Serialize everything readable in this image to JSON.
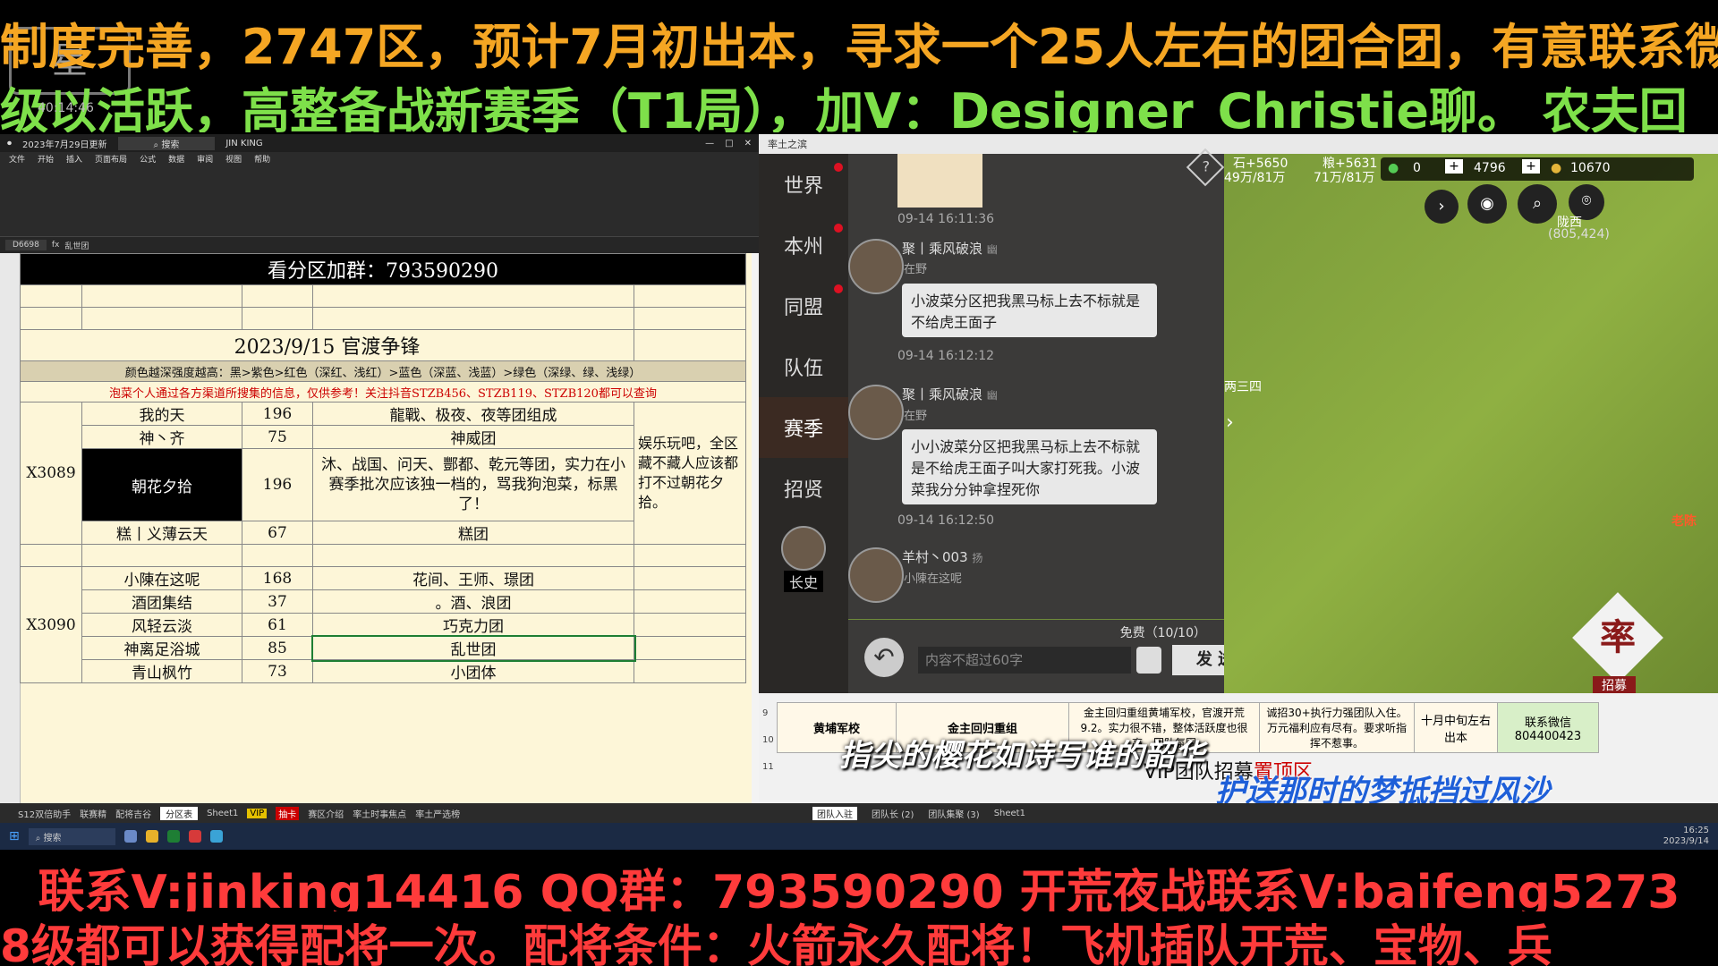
{
  "banners": {
    "top1": "制度完善，2747区，预计7月初出本，寻求一个25人左右的团合团，有意联系微信",
    "top2": "级以活跃，高整备战新赛季（T1局），加V：Designer_Christie聊。    农夫回",
    "bottom1": "联系V:jinking14416    QQ群：793590290  开荒夜战联系V:baifeng5273",
    "bottom2": "8级都可以获得配将一次。配将条件：火箭永久配将！飞机插队开荒、宝物、兵",
    "stamp": "40:14:46"
  },
  "excel": {
    "window_title": "2023年7月29日更新",
    "search_placeholder": "搜索",
    "user": "JIN KING",
    "menu": [
      "文件",
      "开始",
      "插入",
      "页面布局",
      "公式",
      "数据",
      "审阅",
      "视图",
      "帮助"
    ],
    "cell_ref": "D6698",
    "formula": "乱世团",
    "header": "看分区加群：793590290",
    "date_title": "2023/9/15  官渡争锋",
    "legend": "颜色越深强度越高：黑>紫色>红色（深红、浅红）>蓝色（深蓝、浅蓝）>绿色（深绿、绿、浅绿）",
    "notice": "泡菜个人通过各方渠道所搜集的信息，仅供参考！关注抖音STZB456、STZB119、STZB120都可以查询",
    "groups": [
      {
        "zone": "X3089",
        "rows": [
          {
            "name": "我的天",
            "num": "196",
            "note": "龍戰、极夜、夜等团组成"
          },
          {
            "name": "神丶齐",
            "num": "75",
            "note": "神威团"
          },
          {
            "name": "朝花夕拾",
            "num": "196",
            "note": "沐、战国、问天、酆都、乾元等团，实力在小赛季批次应该独一档的，骂我狗泡菜，标黑了！"
          },
          {
            "name": "糕丨义薄云天",
            "num": "67",
            "note": "糕团"
          }
        ],
        "remark": "娱乐玩吧，全区藏不藏人应该都打不过朝花夕拾。"
      },
      {
        "zone": "X3090",
        "rows": [
          {
            "name": "小陳在这呢",
            "num": "168",
            "note": "花间、王师、璟团"
          },
          {
            "name": "酒团集结",
            "num": "37",
            "note": "。酒、浪团"
          },
          {
            "name": "风轻云淡",
            "num": "61",
            "note": "巧克力团"
          },
          {
            "name": "神离足浴城",
            "num": "85",
            "note": "乱世团"
          },
          {
            "name": "青山枫竹",
            "num": "73",
            "note": "小团体"
          }
        ]
      }
    ],
    "sheet_tabs": [
      "S12双倍助手",
      "联赛精",
      "配将吉谷",
      "分区表",
      "Sheet1",
      "VIP",
      "抽卡",
      "赛区介绍",
      "率土时事焦点",
      "率土严选榜"
    ]
  },
  "game": {
    "window_title": "率土之滨",
    "sidebar": [
      "世界",
      "本州",
      "同盟",
      "队伍",
      "赛季",
      "招贤"
    ],
    "sidebar_role": "长史",
    "messages": [
      {
        "time": "09-14 16:11:36"
      },
      {
        "name": "聚丨乘风破浪",
        "tag": "幽",
        "status": "在野",
        "text": "小波菜分区把我黑马标上去不标就是不给虎王面子",
        "time": "09-14 16:12:12"
      },
      {
        "name": "聚丨乘风破浪",
        "tag": "幽",
        "status": "在野",
        "text": "小小波菜分区把我黑马标上去不标就是不给虎王面子叫大家打死我。小波菜我分分钟拿捏死你",
        "time": "09-14 16:12:50"
      },
      {
        "name": "羊村丶003",
        "tag": "扬",
        "status": "小陳在这呢"
      }
    ],
    "free_label": "免费（10/10）",
    "input_placeholder": "内容不超过60字",
    "send_label": "发 送",
    "resources": {
      "stone": "石+5650",
      "stone_cap": "49万/81万",
      "grain": "粮+5631",
      "grain_cap": "71万/81万",
      "jade": "0",
      "gold": "4796",
      "copper": "10670"
    },
    "location": "陇西",
    "coords": "(805,424)",
    "map_label": "两三四",
    "npc_label": "老陈",
    "recruit_label": "招募",
    "recruit_big": "率"
  },
  "strip": {
    "cells": [
      "黄埔军校",
      "金主回归重组",
      "金主回归重组黄埔军校，官渡开荒9.2。实力很不错，整体活跃度也很高。团队氛围",
      "诚招30+执行力强团队入住。万元福利应有尽有。要求听指挥不惹事。",
      "十月中旬左右出本",
      "联系微信804400423"
    ],
    "row_nums": [
      "9",
      "10",
      "11"
    ],
    "overlay": "VIP团队招募",
    "overlay_red": "置顶区",
    "lyric1": "指尖的樱花如诗写谁的韶华",
    "lyric2": "护送那时的梦抵挡过风沙",
    "tabs": [
      "团队入驻",
      "团队长 (2)",
      "团队集聚 (3)",
      "Sheet1"
    ]
  },
  "taskbar": {
    "search": "搜索",
    "time": "16:25",
    "date": "2023/9/14"
  }
}
